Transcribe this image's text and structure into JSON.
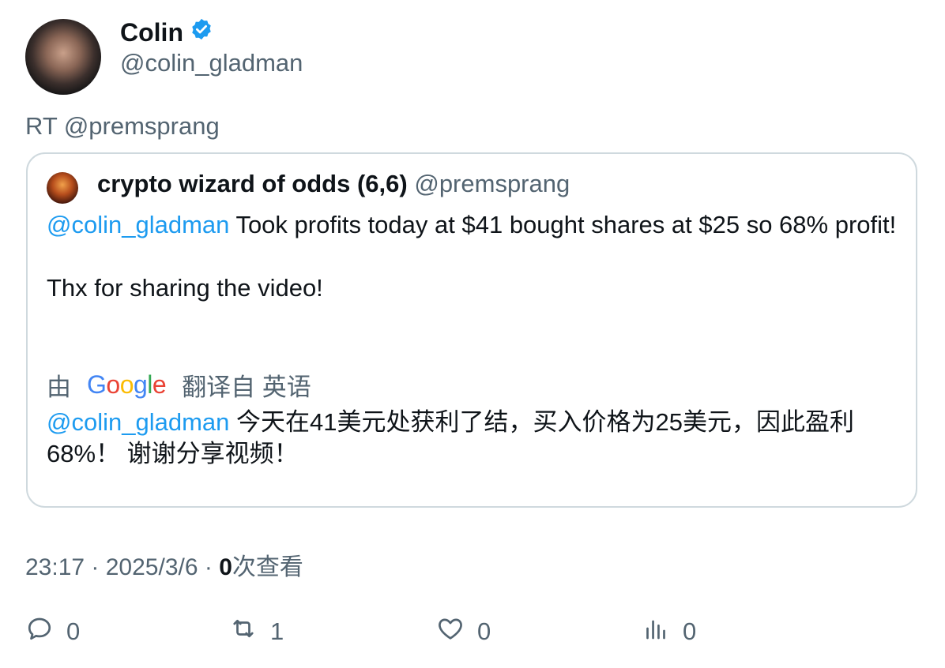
{
  "author": {
    "name": "Colin",
    "handle": "@colin_gladman"
  },
  "retweet_line": "RT @premsprang",
  "quote": {
    "name": "crypto wizard of odds (6,6)",
    "handle": "@premsprang",
    "mention": "@colin_gladman",
    "line1_rest": " Took profits today at $41 bought shares at $25 so 68% profit!",
    "line2": "Thx for sharing the video!",
    "translate_by": "由",
    "google": "Google",
    "translate_from": "翻译自 英语",
    "translated_mention": "@colin_gladman",
    "translated_rest": " 今天在41美元处获利了结，买入价格为25美元，因此盈利68%！ 谢谢分享视频！"
  },
  "meta": {
    "time": "23:17",
    "sep1": " · ",
    "date": "2025/3/6",
    "sep2": " · ",
    "views": "0",
    "views_label": "次查看"
  },
  "actions": {
    "replies": "0",
    "retweets": "1",
    "likes": "0",
    "views": "0"
  },
  "colors": {
    "link": "#1d9bf0",
    "muted": "#536471",
    "verified": "#1d9bf0"
  },
  "icons": [
    "verified-badge-icon",
    "reply-icon",
    "retweet-icon",
    "like-icon",
    "views-icon"
  ]
}
